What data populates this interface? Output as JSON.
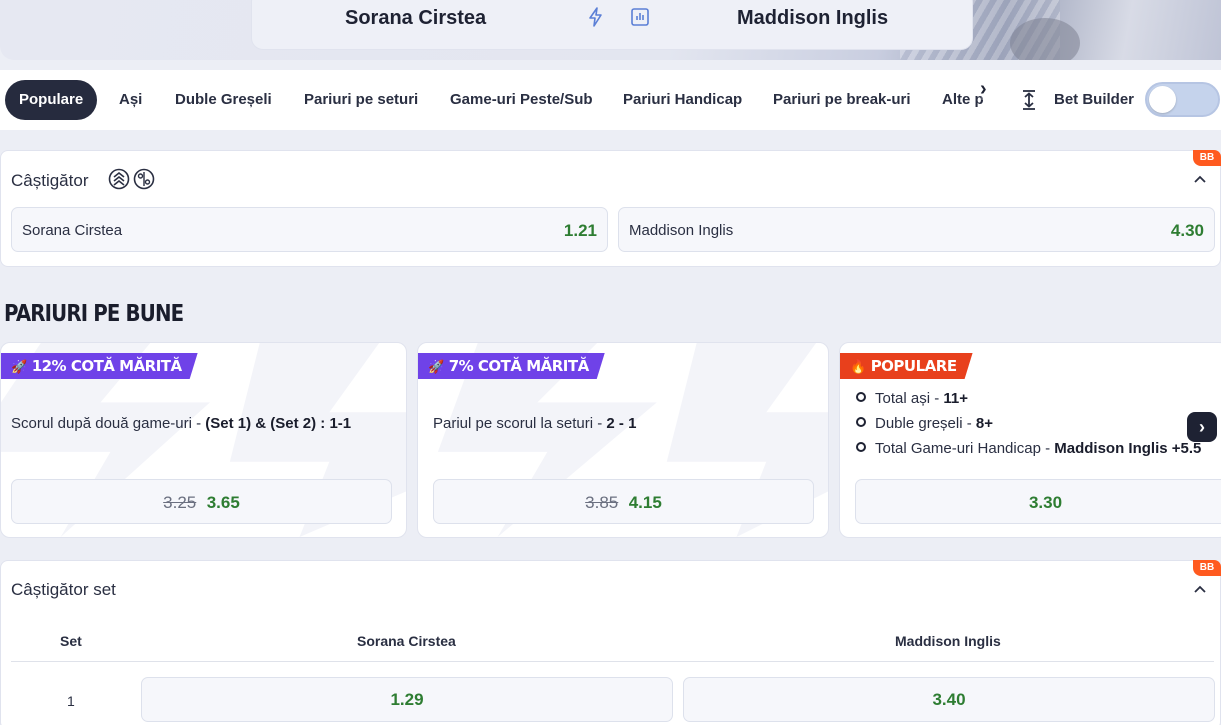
{
  "match": {
    "player1": "Sorana Cirstea",
    "player2": "Maddison Inglis",
    "icons": [
      "lightning-icon",
      "stats-icon"
    ]
  },
  "tabs": [
    {
      "label": "Populare",
      "active": true
    },
    {
      "label": "Ași",
      "active": false
    },
    {
      "label": "Duble Greșeli",
      "active": false
    },
    {
      "label": "Pariuri pe seturi",
      "active": false
    },
    {
      "label": "Game-uri Peste/Sub",
      "active": false
    },
    {
      "label": "Pariuri Handicap",
      "active": false
    },
    {
      "label": "Pariuri pe break-uri",
      "active": false
    },
    {
      "label": "Alte p",
      "active": false
    }
  ],
  "bet_builder": {
    "label": "Bet Builder",
    "enabled": false
  },
  "winner_market": {
    "title": "Câștigător",
    "badge": "BB",
    "options": [
      {
        "label": "Sorana Cirstea",
        "odd": "1.21"
      },
      {
        "label": "Maddison Inglis",
        "odd": "4.30"
      }
    ]
  },
  "featured": {
    "title": "PARIURI PE BUNE",
    "cards": [
      {
        "tag": "12% COTĂ MĂRITĂ",
        "tag_type": "boost",
        "desc_pre": "Scorul după două game-uri - ",
        "desc_bold": "(Set 1) & (Set 2) : 1-1",
        "old_odd": "3.25",
        "new_odd": "3.65"
      },
      {
        "tag": "7% COTĂ MĂRITĂ",
        "tag_type": "boost",
        "desc_pre": "Pariul pe scorul la seturi - ",
        "desc_bold": "2 - 1",
        "old_odd": "3.85",
        "new_odd": "4.15"
      },
      {
        "tag": "POPULARE",
        "tag_type": "popular",
        "legs": [
          {
            "pre": "Total ași - ",
            "bold": "11+"
          },
          {
            "pre": "Duble greșeli - ",
            "bold": "8+"
          },
          {
            "pre": "Total Game-uri Handicap - ",
            "bold": "Maddison Inglis +5.5"
          }
        ],
        "new_odd": "3.30"
      }
    ]
  },
  "set_winner_market": {
    "title": "Câștigător set",
    "badge": "BB",
    "headers": [
      "Set",
      "Sorana Cirstea",
      "Maddison Inglis"
    ],
    "rows": [
      {
        "set": "1",
        "odd1": "1.29",
        "odd2": "3.40"
      }
    ]
  },
  "colors": {
    "odd_green": "#2e7d32",
    "boost_purple": "#6f42e8",
    "popular_orange": "#e8401c",
    "bb_badge": "#ff5a1f",
    "dark": "#262b3e"
  }
}
